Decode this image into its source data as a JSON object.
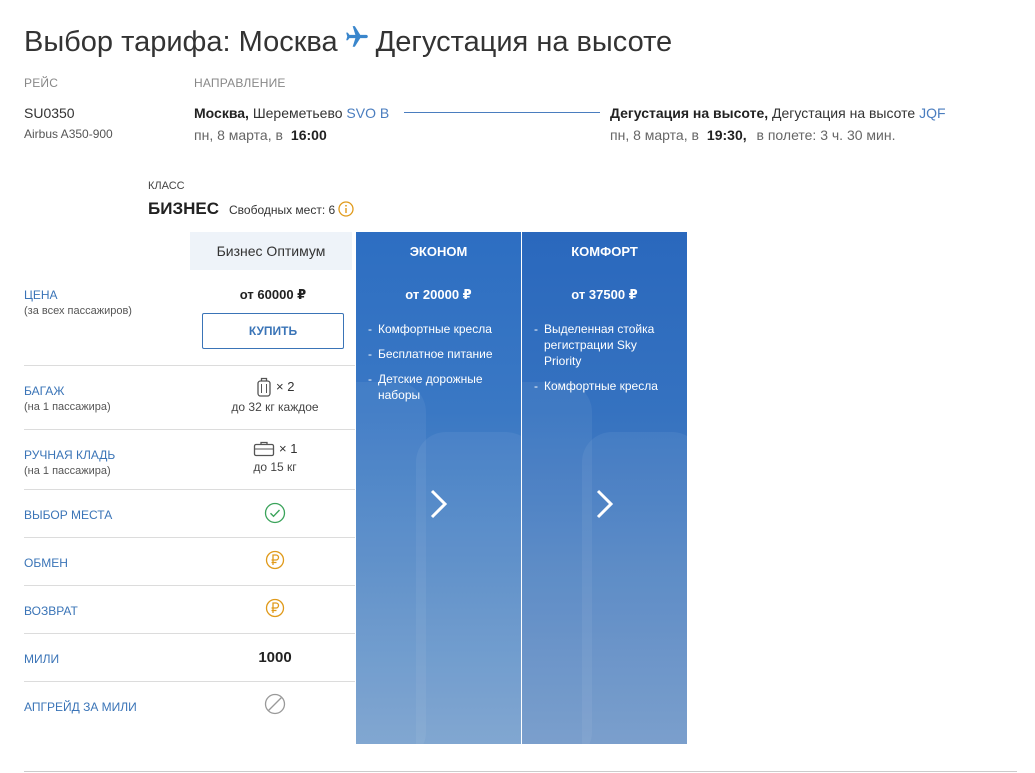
{
  "header": {
    "title_prefix": "Выбор тарифа: Москва",
    "title_suffix": "Дегустация на высоте"
  },
  "flight": {
    "label": "РЕЙС",
    "number": "SU0350",
    "aircraft": "Airbus A350-900"
  },
  "route": {
    "label": "НАПРАВЛЕНИЕ",
    "departure": {
      "city": "Москва,",
      "airport": "Шереметьево",
      "code": "SVO B",
      "date": "пн, 8 марта, в",
      "time": "16:00"
    },
    "arrival": {
      "city": "Дегустация на высоте,",
      "airport": "Дегустация на высоте",
      "code": "JQF",
      "date": "пн, 8 марта, в",
      "time": "19:30,",
      "duration": "в полете: 3 ч. 30 мин."
    }
  },
  "fare_class": {
    "label": "КЛАСС",
    "name": "БИЗНЕС",
    "seats": "Свободных мест: 6"
  },
  "tariff": {
    "name": "Бизнес Оптимум",
    "price": "от 60000 ₽",
    "buy_label": "КУПИТЬ",
    "baggage_count": "× 2",
    "baggage_sub": "до 32 кг каждое",
    "hand_count": "× 1",
    "hand_sub": "до 15 кг",
    "miles": "1000"
  },
  "rows": {
    "price": {
      "label": "ЦЕНА",
      "sub": "(за всех пассажиров)"
    },
    "baggage": {
      "label": "БАГАЖ",
      "sub": "(на 1 пассажира)"
    },
    "hand": {
      "label": "РУЧНАЯ КЛАДЬ",
      "sub": "(на 1 пассажира)"
    },
    "seat": {
      "label": "ВЫБОР МЕСТА"
    },
    "exchange": {
      "label": "ОБМЕН"
    },
    "refund": {
      "label": "ВОЗВРАТ"
    },
    "miles": {
      "label": "МИЛИ"
    },
    "upgrade": {
      "label": "АПГРЕЙД ЗА МИЛИ"
    }
  },
  "cards": {
    "economy": {
      "title": "ЭКОНОМ",
      "price": "от 20000 ₽",
      "features": [
        "Комфортные кресла",
        "Бесплатное питание",
        "Детские дорожные наборы"
      ]
    },
    "comfort": {
      "title": "КОМФОРТ",
      "price": "от 37500 ₽",
      "features": [
        "Выделенная стойка регистрации Sky Priority",
        "Комфортные кресла"
      ]
    }
  },
  "colors": {
    "accent": "#3a74b7",
    "check": "#3aa35a",
    "paid": "#e09a1a",
    "disabled": "#999999"
  }
}
